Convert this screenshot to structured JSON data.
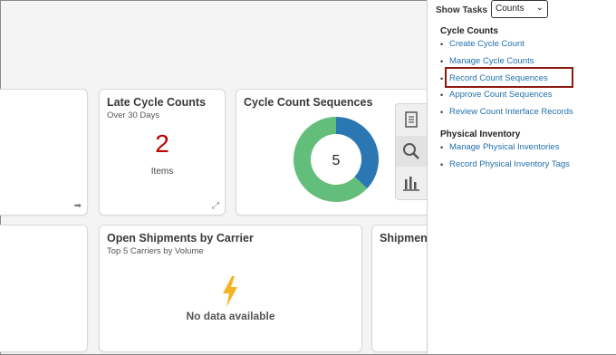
{
  "cards": {
    "late_cycle": {
      "title": "Late Cycle Counts",
      "subtitle": "Over 30 Days",
      "value": "2",
      "unit": "Items"
    },
    "sequences": {
      "title": "Cycle Count Sequences",
      "center_value": "5",
      "donut_colors": [
        "#2a77b4",
        "#62be7a"
      ]
    },
    "shipments": {
      "title": "Open Shipments by Carrier",
      "subtitle": "Top 5 Carriers by Volume",
      "message": "No data available"
    },
    "shipment_partial": {
      "title": "Shipmen"
    }
  },
  "panel": {
    "show_tasks_label": "Show Tasks",
    "select_value": "Counts",
    "sections": [
      {
        "title": "Cycle Counts",
        "links": [
          "Create Cycle Count",
          "Manage Cycle Counts",
          "Record Count Sequences",
          "Approve Count Sequences",
          "Review Count Interface Records"
        ]
      },
      {
        "title": "Physical Inventory",
        "links": [
          "Manage Physical Inventories",
          "Record Physical Inventory Tags"
        ]
      }
    ]
  },
  "colors": {
    "link": "#1f6fab",
    "highlight": "#8b1a10",
    "late_value": "#c00000"
  }
}
